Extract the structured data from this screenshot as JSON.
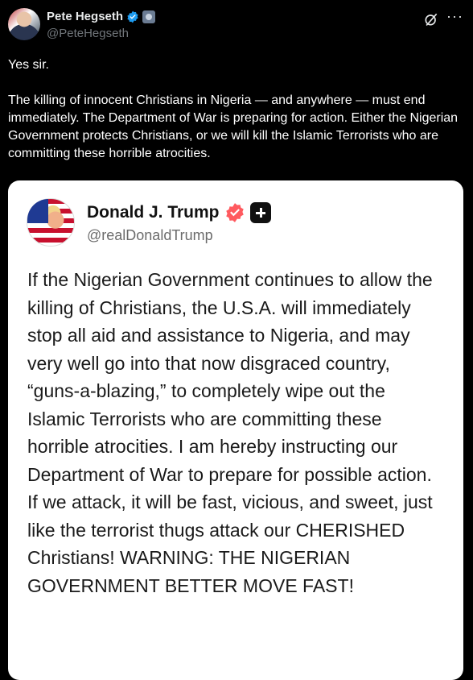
{
  "post": {
    "author_name": "Pete Hegseth",
    "author_handle": "@PeteHegseth",
    "more_label": "···",
    "paragraphs": [
      "Yes sir.",
      "The killing of innocent Christians in Nigeria — and anywhere — must end immediately. The Department of War is preparing for action. Either the Nigerian Government protects Christians, or we will kill the Islamic Terrorists who are committing these horrible atrocities."
    ]
  },
  "quoted": {
    "author_name": "Donald J. Trump",
    "author_handle": "@realDonaldTrump",
    "text": "If the Nigerian Government continues to allow the killing of Christians, the U.S.A. will immediately stop all aid and assistance to Nigeria, and may very well go into that now disgraced country, “guns-a-blazing,” to completely wipe out the Islamic Terrorists who are committing these horrible atrocities. I am hereby instructing our Department of War to prepare for possible action. If we attack, it will be fast, vicious, and sweet, just like the terrorist thugs attack our CHERISHED Christians! WARNING: THE NIGERIAN GOVERNMENT BETTER MOVE FAST!"
  },
  "colors": {
    "background": "#000000",
    "text": "#e7e9ea",
    "muted": "#71767b",
    "verified_blue": "#1d9bf0",
    "truth_verified": "#ff5a5f",
    "card": "#ffffff"
  },
  "icons": {
    "verified": "verified-badge-icon",
    "government": "government-badge-icon",
    "grok": "grok-icon",
    "more": "more-icon",
    "truth_verified": "truth-verified-icon",
    "truth_plus": "truth-plus-icon"
  }
}
